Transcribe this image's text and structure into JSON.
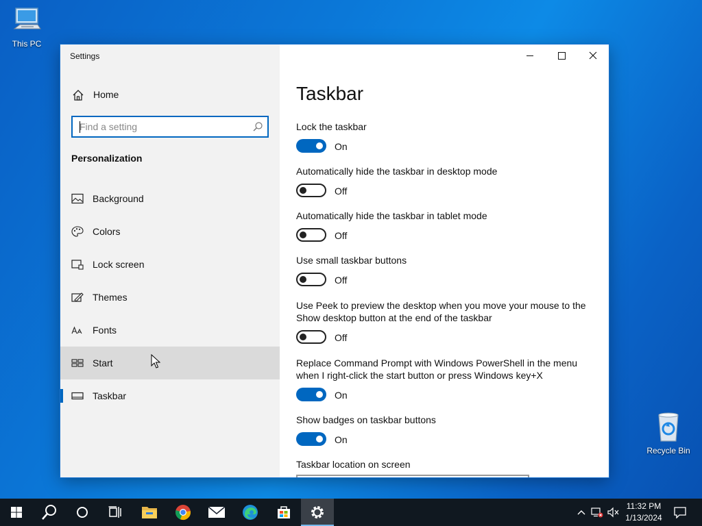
{
  "desktop": {
    "icons": [
      {
        "label": "This PC"
      },
      {
        "label": "Recycle Bin"
      }
    ]
  },
  "window": {
    "title": "Settings",
    "controls": [
      "minimize-icon",
      "maximize-icon",
      "close-icon"
    ]
  },
  "sidebar": {
    "home_label": "Home",
    "search_placeholder": "Find a setting",
    "section_label": "Personalization",
    "items": [
      {
        "label": "Background",
        "icon": "picture-icon"
      },
      {
        "label": "Colors",
        "icon": "palette-icon"
      },
      {
        "label": "Lock screen",
        "icon": "lock-screen-icon"
      },
      {
        "label": "Themes",
        "icon": "themes-icon"
      },
      {
        "label": "Fonts",
        "icon": "fonts-icon"
      },
      {
        "label": "Start",
        "icon": "start-icon"
      },
      {
        "label": "Taskbar",
        "icon": "taskbar-icon"
      }
    ],
    "hovered_item": "Start",
    "selected_item": "Taskbar"
  },
  "content": {
    "title": "Taskbar",
    "settings": [
      {
        "label": "Lock the taskbar",
        "on": true,
        "state": "On"
      },
      {
        "label": "Automatically hide the taskbar in desktop mode",
        "on": false,
        "state": "Off"
      },
      {
        "label": "Automatically hide the taskbar in tablet mode",
        "on": false,
        "state": "Off"
      },
      {
        "label": "Use small taskbar buttons",
        "on": false,
        "state": "Off"
      },
      {
        "label": "Use Peek to preview the desktop when you move your mouse to the Show desktop button at the end of the taskbar",
        "on": false,
        "state": "Off"
      },
      {
        "label": "Replace Command Prompt with Windows PowerShell in the menu when I right-click the start button or press Windows key+X",
        "on": true,
        "state": "On"
      },
      {
        "label": "Show badges on taskbar buttons",
        "on": true,
        "state": "On"
      }
    ],
    "location_label": "Taskbar location on screen"
  },
  "taskbar": {
    "apps": [
      "start-icon",
      "search-icon",
      "cortana-icon",
      "task-view-icon",
      "file-explorer-icon",
      "chrome-icon",
      "mail-icon",
      "edge-icon",
      "store-icon",
      "settings-icon"
    ],
    "active_app": "settings-icon",
    "clock_time": "11:32 PM",
    "clock_date": "1/13/2024",
    "colors": {
      "accent": "#0067c0",
      "taskbar_bg": "#101820"
    }
  }
}
